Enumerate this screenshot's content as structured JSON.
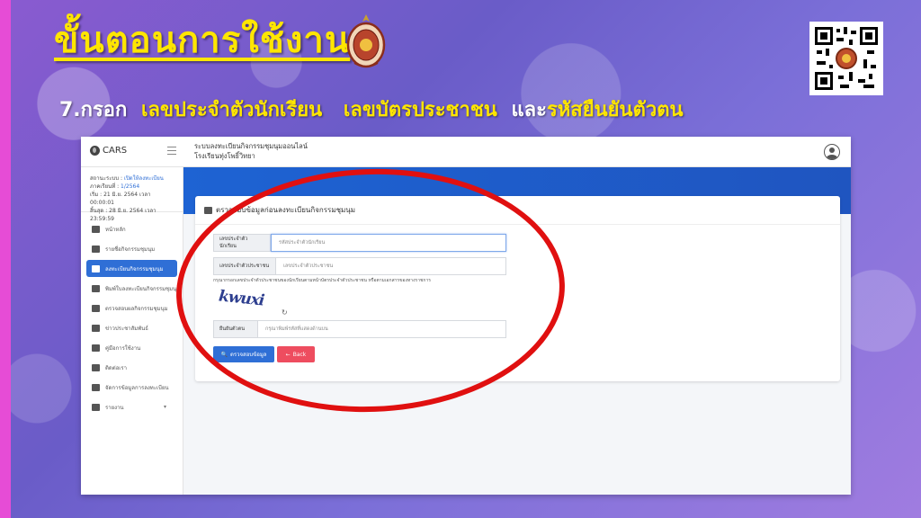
{
  "slide": {
    "title": "ขั้นตอนการใช้งาน",
    "instruction_step": "7.กรอก",
    "instruction_field1": "เลขประจำตัวนักเรียน",
    "instruction_field2": "เลขบัตรประชาชน",
    "instruction_and": "และ",
    "instruction_field3": "รหัสยืนยันตัวตน",
    "colors": {
      "title": "#ffe600",
      "highlight": "#ffe600",
      "left_bar": "#e64cd6",
      "callout": "#e01010"
    }
  },
  "app": {
    "brand": "CARS",
    "system_title_line1": "ระบบลงทะเบียนกิจกรรมชุมนุมออนไลน์",
    "system_title_line2": "โรงเรียนทุ่งโพธิ์วิทยา",
    "status": {
      "label": "สถานะระบบ :",
      "value": "เปิดให้ลงทะเบียน",
      "term_label": "ภาคเรียนที่ :",
      "term_value": "1/2564",
      "start": "เริ่ม : 21 มิ.ย. 2564 เวลา 00:00:01",
      "end": "สิ้นสุด : 28 มิ.ย. 2564 เวลา 23:59:59"
    },
    "sidebar_items": [
      {
        "label": "หน้าหลัก",
        "icon": "home-icon"
      },
      {
        "label": "รายชื่อกิจกรรมชุมนุม",
        "icon": "book-icon"
      },
      {
        "label": "ลงทะเบียนกิจกรรมชุมนุม",
        "icon": "edit-icon",
        "active": true
      },
      {
        "label": "พิมพ์ใบลงทะเบียนกิจกรรมชุมนุม",
        "icon": "print-icon"
      },
      {
        "label": "ตรวจสอบผลกิจกรรมชุมนุม",
        "icon": "graduation-icon"
      },
      {
        "label": "ข่าวประชาสัมพันธ์",
        "icon": "newspaper-icon"
      },
      {
        "label": "คู่มือการใช้งาน",
        "icon": "manual-icon"
      },
      {
        "label": "ติดต่อเรา",
        "icon": "chat-icon"
      },
      {
        "label": "จัดการข้อมูลการลงทะเบียน",
        "icon": "list-icon"
      },
      {
        "label": "รายงาน",
        "icon": "print-icon",
        "has_caret": true
      }
    ],
    "card": {
      "title": "ตรวจสอบข้อมูลก่อนลงทะเบียนกิจกรรมชุมนุม",
      "student_id_label": "เลขประจำตัวนักเรียน",
      "student_id_placeholder": "รหัสประจำตัวนักเรียน",
      "citizen_id_label": "เลขประจำตัวประชาชน",
      "citizen_id_placeholder": "เลขประจำตัวประชาชน",
      "hint": "กรุณากรอกเลขประจำตัวประชาชนของนักเรียนตามหน้าบัตรประจำตัวประชาชน หรือตามเอกสารของทางราชการ",
      "captcha_text": "kwuxi",
      "refresh_icon": "↻",
      "verify_label": "ยืนยันตัวตน",
      "verify_placeholder": "กรุณาพิมพ์รหัสที่แสดงด้านบน",
      "check_button": "ตรวจสอบข้อมูล",
      "back_button": "Back"
    }
  }
}
